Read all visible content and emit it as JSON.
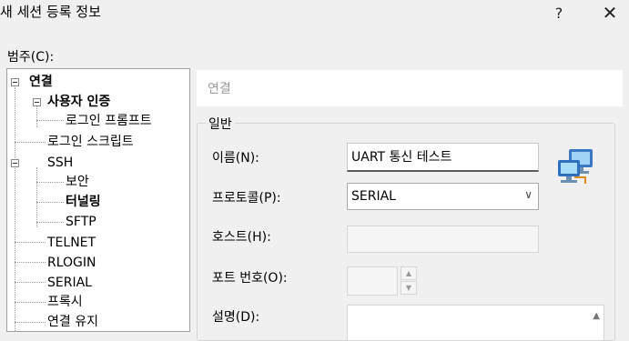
{
  "window": {
    "title": "새 세션 등록 정보",
    "help_label": "?",
    "close_label": "✕"
  },
  "category_label": "범주(C):",
  "tree": {
    "items": [
      {
        "label": "연결"
      },
      {
        "label": "사용자 인증"
      },
      {
        "label": "로그인 프롬프트"
      },
      {
        "label": "로그인 스크립트"
      },
      {
        "label": "SSH"
      },
      {
        "label": "보안"
      },
      {
        "label": "터널링"
      },
      {
        "label": "SFTP"
      },
      {
        "label": "TELNET"
      },
      {
        "label": "RLOGIN"
      },
      {
        "label": "SERIAL"
      },
      {
        "label": "프록시"
      },
      {
        "label": "연결 유지"
      }
    ]
  },
  "panel": {
    "header": "연결",
    "group_title": "일반",
    "name_label": "이름(N):",
    "name_value": "UART 통신 테스트",
    "protocol_label": "프로토콜(P):",
    "protocol_value": "SERIAL",
    "host_label": "호스트(H):",
    "host_value": "",
    "port_label": "포트 번호(O):",
    "port_value": "",
    "desc_label": "설명(D):",
    "desc_value": ""
  },
  "icons": {
    "help": "help-icon",
    "close": "close-icon",
    "protocol_dropdown": "chevron-down-icon",
    "spinner_up": "arrow-up-icon",
    "spinner_down": "arrow-down-icon",
    "session": "network-computers-icon"
  }
}
